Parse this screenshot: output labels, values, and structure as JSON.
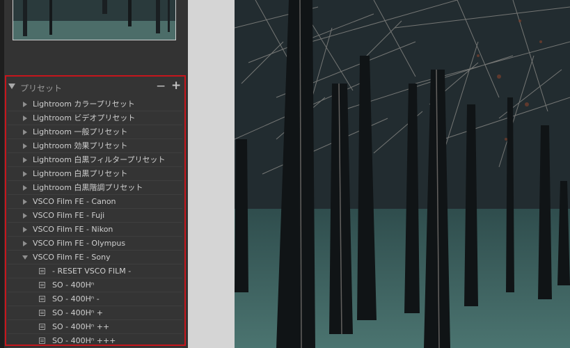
{
  "presets_panel": {
    "title": "プリセット",
    "minus_label": "−",
    "plus_label": "+",
    "items": [
      {
        "type": "folder",
        "label": "Lightroom カラープリセット"
      },
      {
        "type": "folder",
        "label": "Lightroom ビデオプリセット"
      },
      {
        "type": "folder",
        "label": "Lightroom 一般プリセット"
      },
      {
        "type": "folder",
        "label": "Lightroom 効果プリセット"
      },
      {
        "type": "folder",
        "label": "Lightroom 白黒フィルタープリセット"
      },
      {
        "type": "folder",
        "label": "Lightroom 白黒プリセット"
      },
      {
        "type": "folder",
        "label": "Lightroom 白黒階調プリセット"
      },
      {
        "type": "folder",
        "label": "VSCO Film FE - Canon"
      },
      {
        "type": "folder",
        "label": "VSCO Film FE - Fuji"
      },
      {
        "type": "folder",
        "label": "VSCO Film FE - Nikon"
      },
      {
        "type": "folder",
        "label": "VSCO Film FE - Olympus"
      },
      {
        "type": "folder",
        "label": "VSCO Film FE - Sony",
        "expanded": true
      },
      {
        "type": "preset",
        "label": "- RESET VSCO FILM -"
      },
      {
        "type": "preset",
        "label": "SO - 400Hⁿ"
      },
      {
        "type": "preset",
        "label": "SO - 400Hⁿ -"
      },
      {
        "type": "preset",
        "label": "SO - 400Hⁿ +"
      },
      {
        "type": "preset",
        "label": "SO - 400Hⁿ ++"
      },
      {
        "type": "preset",
        "label": "SO - 400Hⁿ +++"
      }
    ]
  },
  "colors": {
    "highlight_border": "#c7161c",
    "panel_bg": "#343434",
    "text": "#cfcfcf"
  }
}
